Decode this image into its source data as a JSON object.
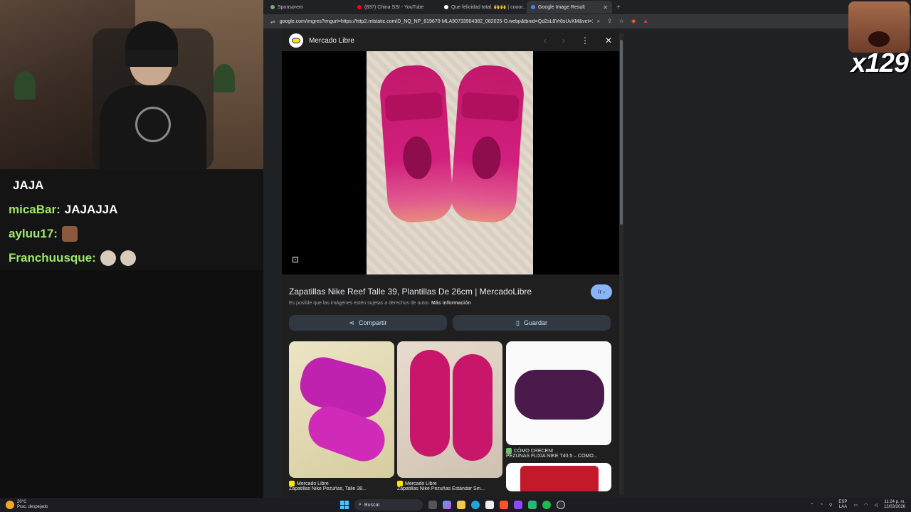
{
  "stream": {
    "chat": [
      {
        "user": "",
        "message": "JAJA"
      },
      {
        "user": "micaBar:",
        "message": "JAJAJJA"
      },
      {
        "user": "ayluu17:",
        "message": ""
      },
      {
        "user": "Franchuusque:",
        "message": ""
      }
    ],
    "counter": "x129"
  },
  "browser": {
    "tabs": [
      {
        "label": "Sponsorem",
        "active": false
      },
      {
        "label": "(837) China SS! - YouTube",
        "active": false
      },
      {
        "label": "Que felicidad total. 🙌🙌 | cooor...",
        "active": false
      },
      {
        "label": "Google Image Result",
        "active": true
      }
    ],
    "url": "google.com/imgres?imgurl=https://http2.mlstatic.com/D_NQ_NP_819670-MLA90733904382_082025-O.webp&tbnid=Qd2sL8Vr8sUvXM&vet=1...",
    "colors": {
      "accent": "#8ab4f8",
      "panel": "#1f1f1f",
      "chrome": "#35363a"
    }
  },
  "viewer": {
    "source": "Mercado Libre",
    "title": "Zapatillas Nike Reef Talle 39, Plantillas De 26cm | MercadoLibre",
    "visit_label": "Ir",
    "copyright_text": "Es posible que las imágenes estén sujetas a derechos de autor.",
    "more_info": "Más información",
    "share_label": "Compartir",
    "save_label": "Guardar",
    "related": [
      {
        "source": "Mercado Libre",
        "caption": "Zapatillas Nike Pezuñas, Talle 38..."
      },
      {
        "source": "Mercado Libre",
        "caption": "Zapatillas Nike Pezuñas Estándar Sin..."
      },
      {
        "source": "CÓMO CRECEN!",
        "caption": "PEZUÑAS FUXIA NIKE T40.5 – CÓMO..."
      }
    ]
  },
  "taskbar": {
    "temp": "20°C",
    "weather": "Prac. despejado",
    "search_label": "Buscar",
    "lang_top": "ESP",
    "lang_bottom": "LAA",
    "time": "11:24 p. m.",
    "date": "12/03/2026"
  }
}
